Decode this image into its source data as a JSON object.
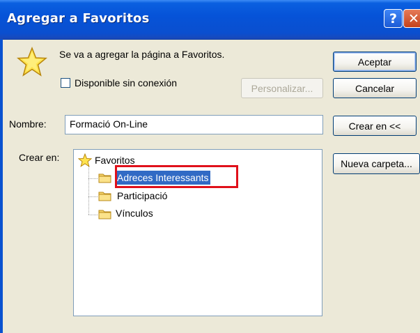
{
  "window": {
    "title": "Agregar a Favoritos",
    "help_label": "?",
    "close_label": "✕"
  },
  "info": {
    "message": "Se va a agregar la página a Favoritos.",
    "offline_label": "Disponible sin conexión",
    "offline_checked": false
  },
  "buttons": {
    "accept": "Aceptar",
    "cancel": "Cancelar",
    "customize": "Personalizar...",
    "create_in": "Crear en <<",
    "new_folder": "Nueva carpeta..."
  },
  "form": {
    "name_label": "Nombre:",
    "name_value": "Formació On-Line",
    "create_in_label": "Crear en:"
  },
  "tree": {
    "root": "Favoritos",
    "items": [
      {
        "label": "Adreces Interessants",
        "selected": true
      },
      {
        "label": "Participació",
        "selected": false
      },
      {
        "label": "Vínculos",
        "selected": false
      }
    ]
  },
  "colors": {
    "titlebar": "#0653d8",
    "selection": "#316ac5",
    "highlight_frame": "#e0101a"
  },
  "icons": [
    "star-icon",
    "folder-icon",
    "help-icon",
    "close-icon"
  ]
}
